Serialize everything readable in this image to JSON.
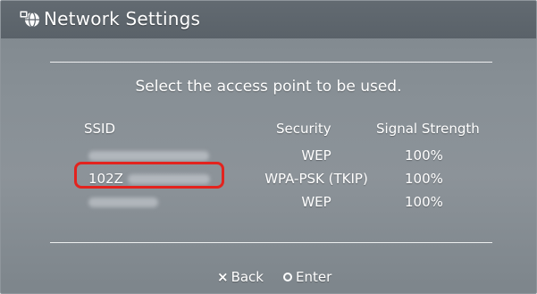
{
  "window": {
    "title": "Network Settings",
    "title_icon": "network-settings-icon"
  },
  "main": {
    "instruction": "Select the access point to be used.",
    "columns": [
      "SSID",
      "Security",
      "Signal Strength"
    ],
    "rows": [
      {
        "ssid": "",
        "ssid_obscured": true,
        "security": "WEP",
        "signal": "100%"
      },
      {
        "ssid": "102Z",
        "ssid_obscured": true,
        "security": "WPA-PSK (TKIP)",
        "signal": "100%",
        "highlighted": true
      },
      {
        "ssid": "",
        "ssid_obscured": true,
        "security": "WEP",
        "signal": "100%"
      }
    ],
    "highlight_color": "#e3231e"
  },
  "footer": {
    "back_icon": "cross-button-icon",
    "back_label": "Back",
    "enter_icon": "circle-button-icon",
    "enter_label": "Enter"
  }
}
